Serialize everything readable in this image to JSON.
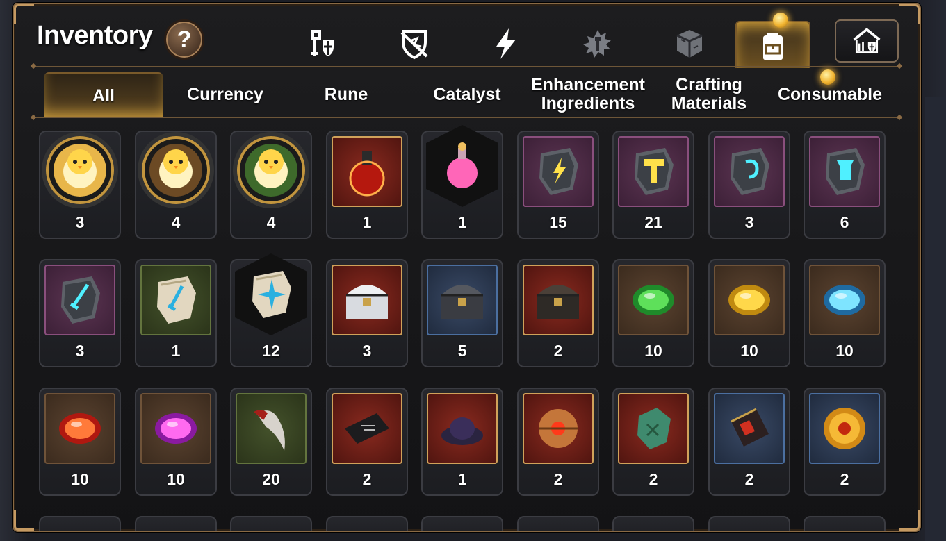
{
  "title": "Inventory",
  "help_label": "?",
  "category_tabs": [
    {
      "icon": "knight-shield-icon"
    },
    {
      "icon": "broken-shield-icon"
    },
    {
      "icon": "lightning-icon"
    },
    {
      "icon": "splash-emblem-icon"
    },
    {
      "icon": "cube-box-icon"
    },
    {
      "icon": "backpack-icon",
      "active": true
    }
  ],
  "extra_button_icon": "guild-house-icon",
  "sub_tabs": [
    {
      "label": "All",
      "active": true
    },
    {
      "label": "Currency"
    },
    {
      "label": "Rune"
    },
    {
      "label": "Catalyst"
    },
    {
      "label": "Enhancement Ingredients"
    },
    {
      "label": "Crafting Materials"
    },
    {
      "label": "Consumable"
    }
  ],
  "items": [
    {
      "icon": "golden-chick-token-icon",
      "frame": "circle",
      "count": "3"
    },
    {
      "icon": "forest-chick-token-icon",
      "frame": "circle",
      "count": "4"
    },
    {
      "icon": "laurel-chick-token-icon",
      "frame": "circle",
      "count": "4"
    },
    {
      "icon": "red-potion-icon",
      "frame": "red",
      "count": "1"
    },
    {
      "icon": "pink-potion-icon",
      "frame": "hex",
      "count": "1"
    },
    {
      "icon": "lightning-rune-stone-icon",
      "frame": "purple",
      "count": "15"
    },
    {
      "icon": "hammer-rune-stone-icon",
      "frame": "purple",
      "count": "21"
    },
    {
      "icon": "swirl-rune-stone-icon",
      "frame": "purple",
      "count": "3"
    },
    {
      "icon": "armor-rune-stone-icon",
      "frame": "purple",
      "count": "6"
    },
    {
      "icon": "sword-rune-stone-icon",
      "frame": "purple",
      "count": "3"
    },
    {
      "icon": "sword-rune-tablet-icon",
      "frame": "green",
      "count": "1"
    },
    {
      "icon": "star-rune-tablet-icon",
      "frame": "hex",
      "count": "12"
    },
    {
      "icon": "silver-chest-icon",
      "frame": "red",
      "count": "3"
    },
    {
      "icon": "dark-chest-icon",
      "frame": "blue",
      "count": "5"
    },
    {
      "icon": "treasure-chest-icon",
      "frame": "red",
      "count": "2"
    },
    {
      "icon": "green-gem-icon",
      "frame": "brown",
      "count": "10"
    },
    {
      "icon": "yellow-gem-icon",
      "frame": "brown",
      "count": "10"
    },
    {
      "icon": "blue-gem-icon",
      "frame": "brown",
      "count": "10"
    },
    {
      "icon": "red-gem-icon",
      "frame": "brown",
      "count": "10"
    },
    {
      "icon": "purple-gem-icon",
      "frame": "brown",
      "count": "10"
    },
    {
      "icon": "beast-claw-icon",
      "frame": "green",
      "count": "20"
    },
    {
      "icon": "circuit-card-icon",
      "frame": "red",
      "count": "2"
    },
    {
      "icon": "dark-powder-icon",
      "frame": "red",
      "count": "1"
    },
    {
      "icon": "mech-core-icon",
      "frame": "red",
      "count": "2"
    },
    {
      "icon": "jade-relic-icon",
      "frame": "red",
      "count": "2"
    },
    {
      "icon": "circuit-board-icon",
      "frame": "blue",
      "count": "2"
    },
    {
      "icon": "sun-coin-icon",
      "frame": "blue",
      "count": "2"
    }
  ],
  "colors": {
    "accent_gold": "#d6a43e",
    "frame_border": "#8a6a44",
    "panel_bg": "#131315"
  }
}
